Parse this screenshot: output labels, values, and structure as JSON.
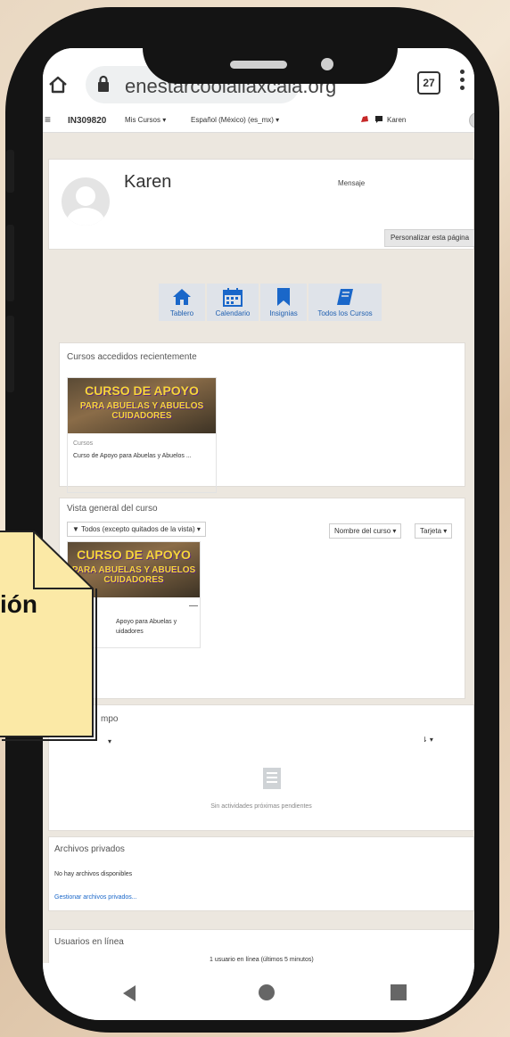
{
  "browser": {
    "url_partial": "enestarcoolaliaxcaia.org",
    "tabs_count": "27"
  },
  "moodle_nav": {
    "course_code": "IN309820",
    "my_courses": "Mis Cursos ▾",
    "language": "Español (México) (es_mx) ▾",
    "user_name": "Karen"
  },
  "profile": {
    "name": "Karen",
    "message_label": "Mensaje",
    "customize_button": "Personalizar esta página"
  },
  "quick_nav": [
    {
      "label": "Tablero",
      "icon": "home-icon"
    },
    {
      "label": "Calendario",
      "icon": "calendar-icon"
    },
    {
      "label": "Insignias",
      "icon": "bookmark-icon"
    },
    {
      "label": "Todos los Cursos",
      "icon": "book-icon"
    }
  ],
  "recent_courses": {
    "title": "Cursos accedidos recientemente",
    "image_line1": "CURSO DE APOYO",
    "image_line2": "PARA ABUELAS Y ABUELOS CUIDADORES",
    "category": "Cursos",
    "course_name": "Curso de Apoyo para Abuelas y Abuelos ..."
  },
  "overview": {
    "title": "Vista general del curso",
    "filter": "▼ Todos (excepto quitados de la vista) ▾",
    "sort": "Nombre del curso ▾",
    "view": "Tarjeta ▾",
    "course_text_line1": "Apoyo para Abuelas y",
    "course_text_line2": "uidadores",
    "dash": "—"
  },
  "timeline": {
    "title_partial": "mpo",
    "empty_text": "Sin actividades próximas pendientes"
  },
  "private_files": {
    "title": "Archivos privados",
    "empty_text": "No hay archivos disponibles",
    "manage_link": "Gestionar archivos privados..."
  },
  "online_users": {
    "title": "Usuarios en línea",
    "count_text": "1 usuario en línea (últimos 5 minutos)"
  },
  "note": {
    "text": "ión"
  },
  "colors": {
    "accent": "#1a67c9",
    "note": "#fbe9a6",
    "phone": "#141414"
  }
}
